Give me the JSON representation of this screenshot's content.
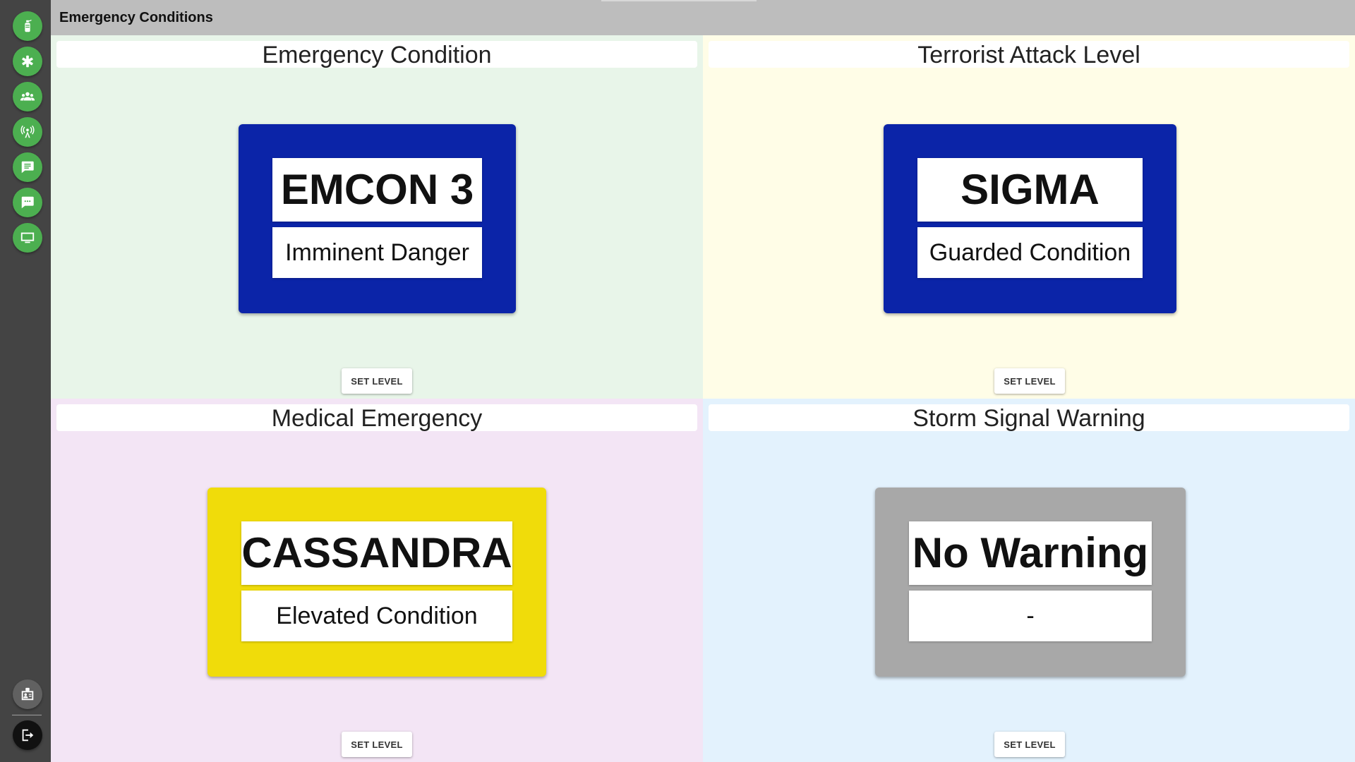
{
  "header": {
    "title": "Emergency Conditions"
  },
  "sidebar": {
    "items": [
      {
        "icon": "fire-extinguisher-icon"
      },
      {
        "icon": "medical-star-icon"
      },
      {
        "icon": "people-group-icon"
      },
      {
        "icon": "radio-tower-icon"
      },
      {
        "icon": "message-icon"
      },
      {
        "icon": "chat-dots-icon"
      },
      {
        "icon": "monitor-icon"
      }
    ],
    "bottom": [
      {
        "icon": "id-badge-icon"
      },
      {
        "icon": "logout-icon"
      }
    ]
  },
  "panels": [
    {
      "title": "Emergency Condition",
      "level": "EMCON 3",
      "description": "Imminent Danger",
      "panel_color": "#0b24a8",
      "background": "#e8f5e9",
      "button": "SET LEVEL"
    },
    {
      "title": "Terrorist Attack Level",
      "level": "SIGMA",
      "description": "Guarded Condition",
      "panel_color": "#0b24a8",
      "background": "#fffde7",
      "button": "SET LEVEL"
    },
    {
      "title": "Medical Emergency",
      "level": "CASSANDRA",
      "description": "Elevated Condition",
      "panel_color": "#f0dc0a",
      "background": "#f3e5f5",
      "button": "SET LEVEL"
    },
    {
      "title": "Storm Signal Warning",
      "level": "No Warning",
      "description": "-",
      "panel_color": "#a8a8a8",
      "background": "#e3f2fd",
      "button": "SET LEVEL"
    }
  ]
}
